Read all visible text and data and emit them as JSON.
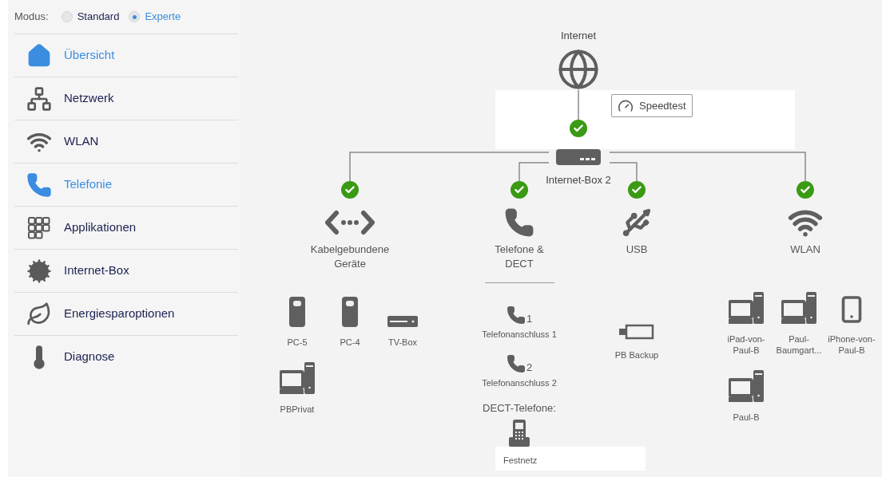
{
  "mode": {
    "label": "Modus:",
    "options": [
      {
        "label": "Standard",
        "selected": false
      },
      {
        "label": "Experte",
        "selected": true
      }
    ]
  },
  "sidebar": {
    "items": [
      {
        "kind": "home",
        "label": "Übersicht",
        "selected": true
      },
      {
        "kind": "network",
        "label": "Netzwerk",
        "selected": false
      },
      {
        "kind": "wifi",
        "label": "WLAN",
        "selected": false
      },
      {
        "kind": "phone",
        "label": "Telefonie",
        "selected": true
      },
      {
        "kind": "apps",
        "label": "Applikationen",
        "selected": false
      },
      {
        "kind": "gears",
        "label": "Internet-Box",
        "selected": false
      },
      {
        "kind": "leaf",
        "label": "Energiesparoptionen",
        "selected": false
      },
      {
        "kind": "thermometer",
        "label": "Diagnose",
        "selected": false
      }
    ]
  },
  "diagram": {
    "internet": {
      "label": "Internet"
    },
    "speedtest": {
      "label": "Speedtest"
    },
    "router": {
      "label": "Internet-Box 2",
      "connected": true
    },
    "branches": [
      {
        "kind": "wired",
        "label": "Kabelgebundene Geräte",
        "connected": true,
        "devices": [
          {
            "kind": "powerline",
            "label": "PC-5"
          },
          {
            "kind": "powerline",
            "label": "PC-4"
          },
          {
            "kind": "tvbox",
            "label": "TV-Box"
          },
          {
            "kind": "computer",
            "label": "PBPrivat"
          }
        ]
      },
      {
        "kind": "phone",
        "label": "Telefone & DECT",
        "connected": true,
        "lines": [
          {
            "number": "1",
            "label": "Telefonanschluss 1"
          },
          {
            "number": "2",
            "label": "Telefonanschluss 2"
          }
        ],
        "dect_heading": "DECT-Telefone:",
        "dect_devices": [
          {
            "label": "Festnetz"
          }
        ]
      },
      {
        "kind": "usb",
        "label": "USB",
        "connected": true,
        "devices": [
          {
            "kind": "usbstick",
            "label": "PB Backup"
          }
        ]
      },
      {
        "kind": "wifi",
        "label": "WLAN",
        "connected": true,
        "devices": [
          {
            "kind": "computer",
            "label": "iPad-von-Paul-B"
          },
          {
            "kind": "computer",
            "label": "Paul-Baumgart..."
          },
          {
            "kind": "smartphone",
            "label": "iPhone-von-Paul-B"
          },
          {
            "kind": "computer",
            "label": "Paul-B"
          }
        ]
      }
    ]
  }
}
